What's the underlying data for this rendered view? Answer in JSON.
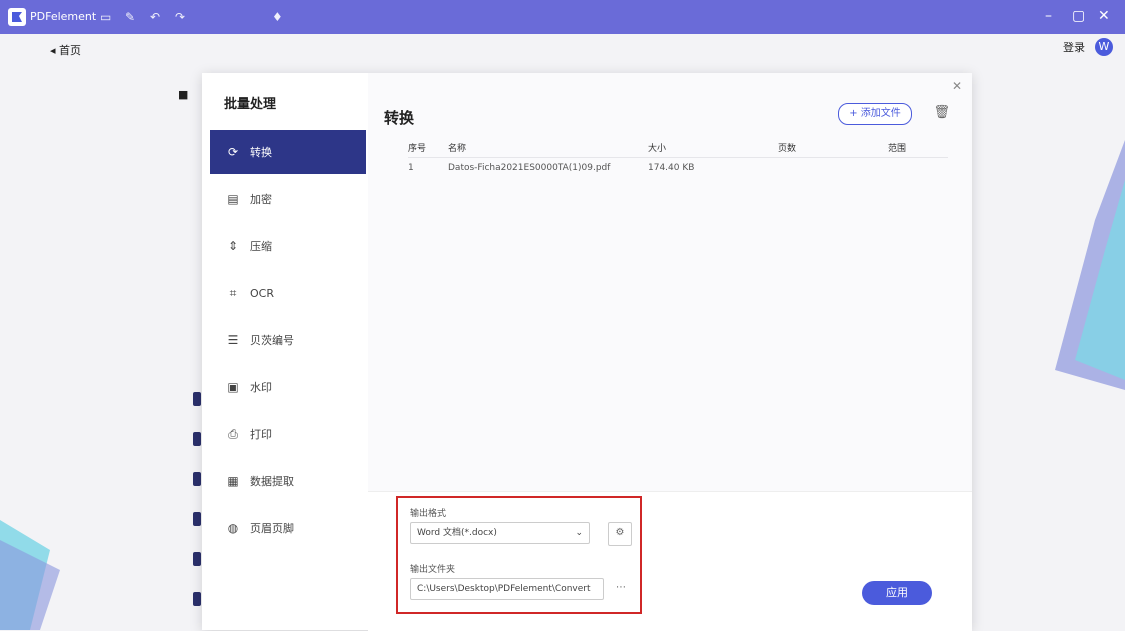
{
  "titlebar": {
    "app_name": "PDFelement",
    "icons": [
      "file-icon",
      "edit-icon",
      "undo-icon",
      "redo-icon",
      "bell-icon"
    ],
    "window_controls": [
      "minimize-icon",
      "maximize-icon",
      "close-icon"
    ]
  },
  "topbar": {
    "home_label": "首页",
    "right_label": "登录",
    "avatar_letter": "W"
  },
  "dialog": {
    "sidebar_title": "批量处理",
    "nav_items": [
      {
        "label": "转换",
        "icon": "convert-icon"
      },
      {
        "label": "加密",
        "icon": "encrypt-icon"
      },
      {
        "label": "压缩",
        "icon": "compress-icon"
      },
      {
        "label": "OCR",
        "icon": "ocr-icon"
      },
      {
        "label": "贝茨编号",
        "icon": "bates-icon"
      },
      {
        "label": "水印",
        "icon": "watermark-icon"
      },
      {
        "label": "打印",
        "icon": "print-icon"
      },
      {
        "label": "数据提取",
        "icon": "data-extract-icon"
      },
      {
        "label": "页眉页脚",
        "icon": "header-footer-icon"
      }
    ],
    "title": "转换",
    "add_button": "+ 添加文件",
    "table": {
      "headers": [
        "序号",
        "名称",
        "大小",
        "页数",
        "范围"
      ],
      "rows": [
        [
          "1",
          "Datos-Ficha2021ES0000TA(1)09.pdf",
          "174.40 KB",
          "",
          ""
        ]
      ]
    },
    "output": {
      "format_label": "输出格式",
      "format_value": "Word 文档(*.docx)",
      "folder_label": "输出文件夹",
      "folder_value": "C:\\Users\\Desktop\\PDFelement\\Convert",
      "settings_icon": "settings-icon",
      "browse_icon": "more-icon"
    },
    "convert_button": "应用"
  }
}
